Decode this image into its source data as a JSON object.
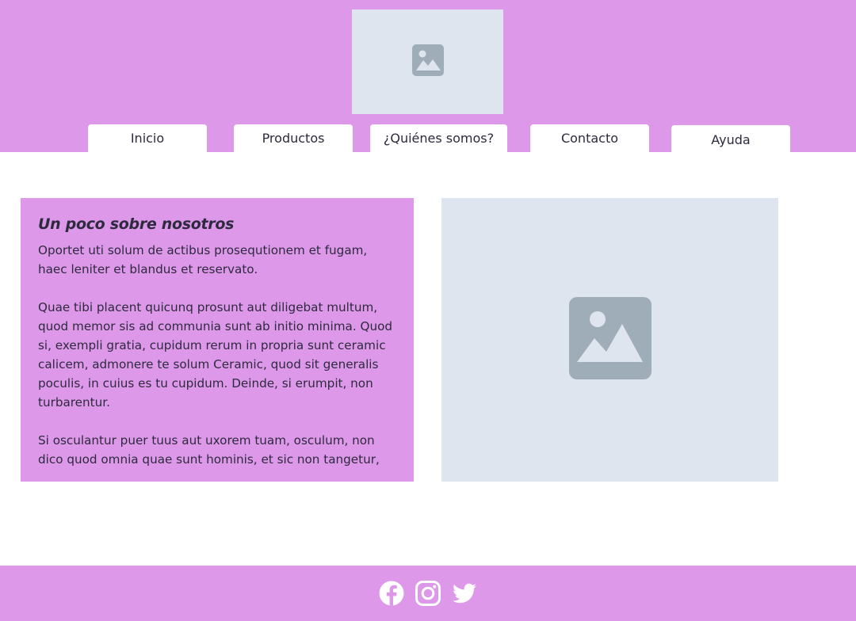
{
  "header": {
    "logo_icon": "image-placeholder-icon",
    "nav": [
      "Inicio",
      "Productos",
      "¿Quiénes somos?",
      "Contacto",
      "Ayuda"
    ]
  },
  "about": {
    "title": "Un poco sobre nosotros",
    "paragraphs": [
      "Oportet uti solum de actibus prosequtionem et fugam, haec leniter et blandus et reservato.",
      "Quae tibi placent quicunq prosunt aut diligebat multum, quod memor sis ad communia sunt ab initio minima. Quod si, exempli gratia, cupidum rerum in propria sunt ceramic calicem, admonere te solum Ceramic, quod sit generalis poculis, in cuius es tu cupidum. Deinde, si erumpit, non turbarentur.",
      "Si osculantur puer tuus aut uxorem tuam, osculum, non dico quod omnia quae sunt hominis, et sic non tangetur,"
    ]
  },
  "hero": {
    "icon": "image-placeholder-icon"
  },
  "footer": {
    "social": [
      "facebook-icon",
      "instagram-icon",
      "twitter-icon"
    ]
  },
  "colors": {
    "accent": "#dd98e9",
    "placeholder": "#dfe5ee",
    "placeholder_icon": "#9fadb9",
    "text": "#2d2a3e",
    "white": "#ffffff"
  }
}
